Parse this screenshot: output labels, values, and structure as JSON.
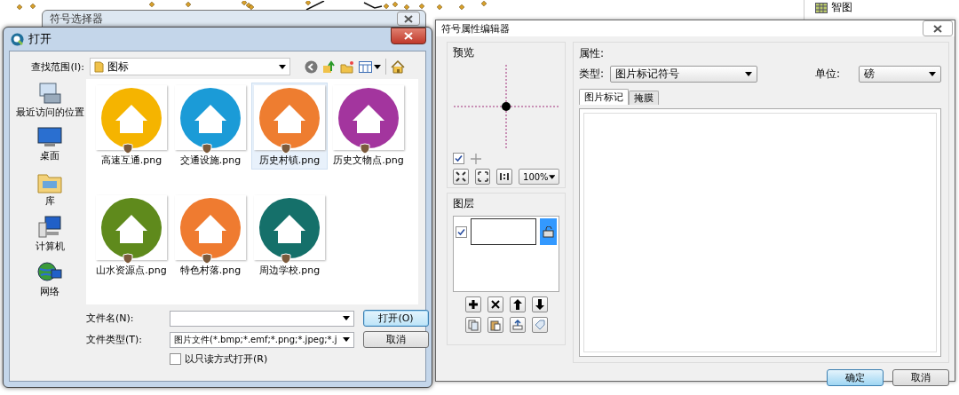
{
  "background_window": {
    "title": "符号选择器"
  },
  "tree": {
    "items": [
      {
        "label": "智图"
      }
    ]
  },
  "open_dialog": {
    "title": "打开",
    "look_in_label": "查找范围(I):",
    "look_in_value": "图标",
    "places": [
      {
        "label": "最近访问的位置",
        "kind": "recent"
      },
      {
        "label": "桌面",
        "kind": "desktop"
      },
      {
        "label": "库",
        "kind": "library"
      },
      {
        "label": "计算机",
        "kind": "computer"
      },
      {
        "label": "网络",
        "kind": "network"
      }
    ],
    "files": [
      {
        "name": "高速互通.png",
        "color": "#f5b400",
        "selected": false
      },
      {
        "name": "交通设施.png",
        "color": "#1b9bd7",
        "selected": false
      },
      {
        "name": "历史村镇.png",
        "color": "#ee7d30",
        "selected": true
      },
      {
        "name": "历史文物点.png",
        "color": "#a3359e",
        "selected": false
      },
      {
        "name": "山水资源点.png",
        "color": "#5f8a1c",
        "selected": false
      },
      {
        "name": "特色村落.png",
        "color": "#ef7b30",
        "selected": false
      },
      {
        "name": "周边学校.png",
        "color": "#15706a",
        "selected": false
      }
    ],
    "filename_label": "文件名(N):",
    "filetype_label": "文件类型(T):",
    "filetype_value": "图片文件(*.bmp;*.emf;*.png;*.jpeg;*.j",
    "readonly_label": "以只读方式打开(R)",
    "readonly_checked": false,
    "buttons": [
      {
        "label": "打开(O)",
        "default": true
      },
      {
        "label": "取消",
        "default": false
      }
    ]
  },
  "symbol_editor": {
    "title": "符号属性编辑器",
    "preview_label": "预览",
    "preview_checked": true,
    "zoom_value": "100%",
    "layers_label": "图层",
    "layers": [
      {
        "checked": true,
        "selected": true
      }
    ],
    "properties_label": "属性:",
    "type_label": "类型:",
    "type_value": "图片标记符号",
    "unit_label": "单位:",
    "unit_value": "磅",
    "tabs": [
      {
        "label": "图片标记",
        "selected": true
      },
      {
        "label": "掩膜",
        "selected": false
      }
    ],
    "buttons": [
      {
        "label": "确定",
        "default": true
      },
      {
        "label": "取消",
        "default": false
      }
    ]
  }
}
